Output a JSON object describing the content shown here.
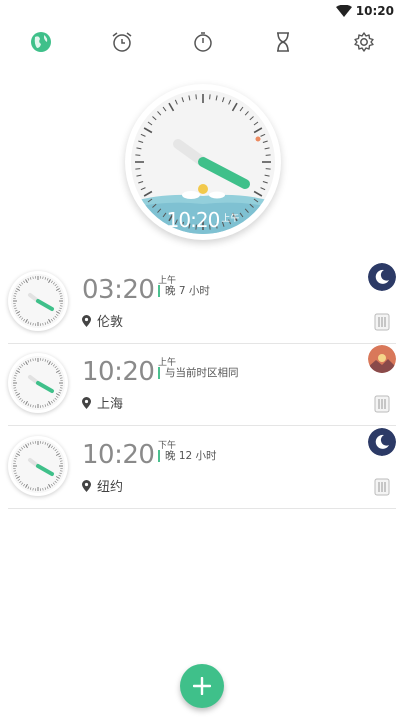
{
  "status": {
    "time": "10:20"
  },
  "tabs": [
    {
      "name": "world-clock",
      "icon": "globe-icon",
      "active": true
    },
    {
      "name": "alarm",
      "icon": "alarm-clock-icon",
      "active": false
    },
    {
      "name": "stopwatch",
      "icon": "stopwatch-icon",
      "active": false
    },
    {
      "name": "timer",
      "icon": "hourglass-icon",
      "active": false
    },
    {
      "name": "settings",
      "icon": "gear-icon",
      "active": false
    }
  ],
  "main_clock": {
    "time": "10:20",
    "ampm": "上午"
  },
  "cities": [
    {
      "time": "03:20",
      "ampm": "上午",
      "diff": "晚 7 小时",
      "city": "伦敦",
      "daynight": "night"
    },
    {
      "time": "10:20",
      "ampm": "上午",
      "diff": "与当前时区相同",
      "city": "上海",
      "daynight": "sunset"
    },
    {
      "time": "10:20",
      "ampm": "下午",
      "diff": "晚 12 小时",
      "city": "纽约",
      "daynight": "night"
    }
  ],
  "colors": {
    "accent": "#3fc08a",
    "night": "#2c3a66",
    "sunset": "#d9785a"
  }
}
